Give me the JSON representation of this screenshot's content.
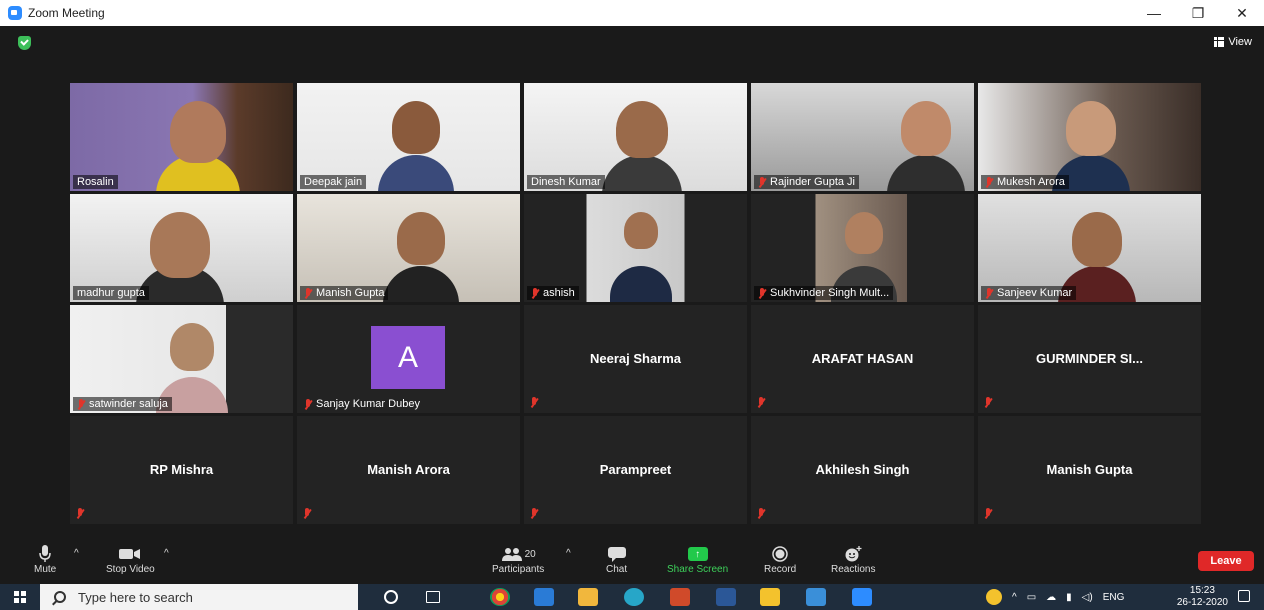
{
  "window": {
    "title": "Zoom Meeting",
    "minimize": "—",
    "restore": "❐",
    "close": "✕"
  },
  "header": {
    "view_label": "View"
  },
  "participants": [
    {
      "name": "Rosalin",
      "type": "video",
      "muted": false,
      "active": true
    },
    {
      "name": "Deepak jain",
      "type": "video",
      "muted": false
    },
    {
      "name": "Dinesh Kumar",
      "type": "video",
      "muted": false
    },
    {
      "name": "Rajinder Gupta Ji",
      "type": "video",
      "muted": true
    },
    {
      "name": "Mukesh Arora",
      "type": "video",
      "muted": true
    },
    {
      "name": "madhur gupta",
      "type": "video",
      "muted": false
    },
    {
      "name": "Manish Gupta",
      "type": "video",
      "muted": true
    },
    {
      "name": "ashish",
      "type": "video",
      "muted": true
    },
    {
      "name": "Sukhvinder Singh Mult...",
      "type": "video",
      "muted": true
    },
    {
      "name": "Sanjeev Kumar",
      "type": "video",
      "muted": true
    },
    {
      "name": "satwinder saluja",
      "type": "video",
      "muted": true
    },
    {
      "name": "Sanjay Kumar Dubey",
      "type": "avatar",
      "avatar_letter": "A",
      "muted": true
    },
    {
      "name": "Neeraj Sharma",
      "type": "name",
      "muted": true
    },
    {
      "name": "ARAFAT HASAN",
      "type": "name",
      "muted": true
    },
    {
      "name": "GURMINDER SI...",
      "type": "name",
      "muted": true
    },
    {
      "name": "RP Mishra",
      "type": "name",
      "muted": true
    },
    {
      "name": "Manish Arora",
      "type": "name",
      "muted": true
    },
    {
      "name": "Parampreet",
      "type": "name",
      "muted": true
    },
    {
      "name": "Akhilesh Singh",
      "type": "name",
      "muted": true
    },
    {
      "name": "Manish Gupta",
      "type": "name",
      "muted": true
    }
  ],
  "controls": {
    "mute": "Mute",
    "stop_video": "Stop Video",
    "participants": "Participants",
    "participants_count": "20",
    "chat": "Chat",
    "share_screen": "Share Screen",
    "record": "Record",
    "reactions": "Reactions",
    "leave": "Leave"
  },
  "taskbar": {
    "search_placeholder": "Type here to search",
    "language": "ENG",
    "time": "15:23",
    "date": "26-12-2020"
  },
  "colors": {
    "active_speaker": "#d6e830",
    "share": "#22c94b",
    "leave": "#e02828",
    "muted": "#e0352b"
  }
}
